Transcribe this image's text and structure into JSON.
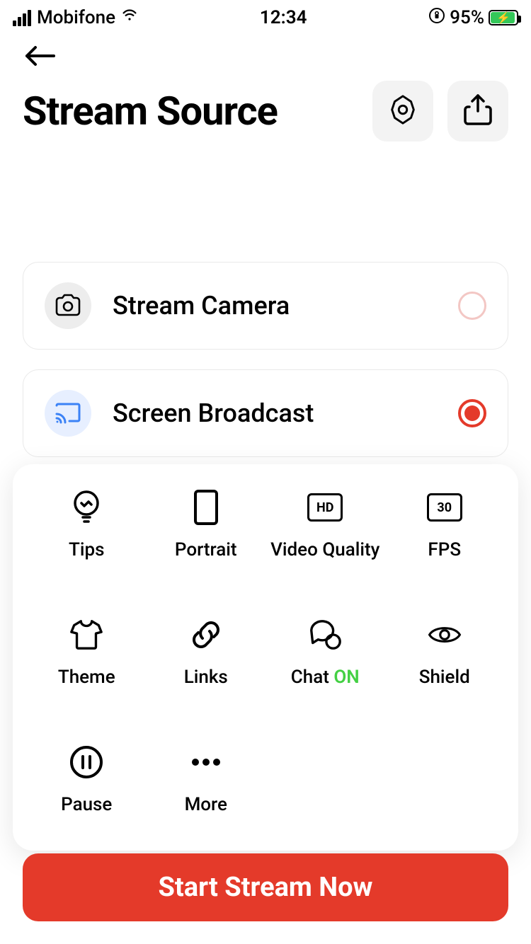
{
  "status": {
    "carrier": "Mobifone",
    "time": "12:34",
    "battery_pct": "95%"
  },
  "header": {
    "title": "Stream Source"
  },
  "sources": [
    {
      "label": "Stream Camera",
      "selected": false
    },
    {
      "label": "Screen Broadcast",
      "selected": true
    }
  ],
  "panel": {
    "tips": "Tips",
    "portrait": "Portrait",
    "video_quality": "Video Quality",
    "video_quality_badge": "HD",
    "fps": "FPS",
    "fps_badge": "30",
    "theme": "Theme",
    "links": "Links",
    "chat": "Chat",
    "chat_state": "ON",
    "shield": "Shield",
    "pause": "Pause",
    "more": "More"
  },
  "cta": {
    "start": "Start Stream Now"
  },
  "colors": {
    "accent": "#e43a2a",
    "chat_on": "#44d044",
    "battery_fill": "#34c759"
  }
}
